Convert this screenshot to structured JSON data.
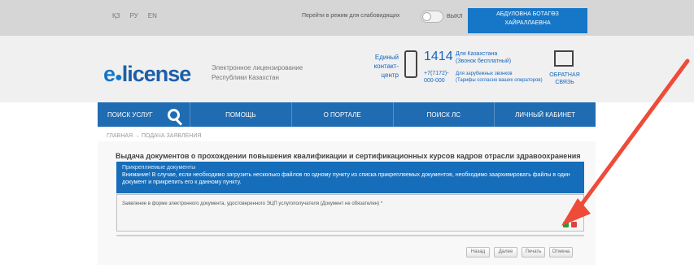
{
  "topbar": {
    "languages": [
      "ҚЗ",
      "РУ",
      "EN"
    ],
    "vision_label": "Перейти в режим для слабовидящих",
    "vision_toggle_state": "ВЫКЛ",
    "user_name": "АБДУЛОВНА БОТАГӨЗ ХАЙРАЛЛАЕВНА"
  },
  "header": {
    "logo_e": "e",
    "logo_dot": "●",
    "logo_text": "license",
    "tagline_line1": "Электронное лицензирование",
    "tagline_line2": "Республики Казахстан",
    "contact_center_lines": [
      "Единый",
      "контакт-",
      "центр"
    ],
    "phone_number": "1414",
    "phone_note_title": "Для Казахстана",
    "phone_note_sub": "(Звонок бесплатный)",
    "phone_number_alt_1": "+7(7172)-",
    "phone_number_alt_2": "000-000",
    "phone_note_alt_title": "Для зарубежных звонков",
    "phone_note_alt_sub": "(Тарифы согласно ваших операторов)",
    "feedback_line1": "ОБРАТНАЯ",
    "feedback_line2": "СВЯЗЬ"
  },
  "nav": {
    "search_label": "ПОИСК УСЛУГ",
    "items": [
      "ПОМОЩЬ",
      "О ПОРТАЛЕ",
      "ПОИСК ЛС",
      "ЛИЧНЫЙ КАБИНЕТ"
    ]
  },
  "breadcrumb": "ГЛАВНАЯ → ПОДАЧА ЗАЯВЛЕНИЯ",
  "main": {
    "title": "Выдача документов о прохождении повышения квалификации и сертификационных курсов кадров отрасли здравоохранения",
    "info_heading": "Прикрепляемые документы",
    "info_body_line1": "Внимание! В случае, если необходимо загрузить несколько файлов по одному пункту из списка прикрепляемых документов, необходимо заархивировать файлы в один",
    "info_body_line2": "документ и прикрепить его к данному пункту.",
    "field_label": "Заявление в форме электронного документа, удостоверенного ЭЦП услугополучателя (Документ не обязателен) *",
    "buttons": [
      "Назад",
      "Далее",
      "Печать",
      "Отмена"
    ]
  },
  "colors": {
    "brand_blue": "#1f6cb3",
    "info_blue": "#166db9",
    "annotation_red": "#ee4b39"
  }
}
